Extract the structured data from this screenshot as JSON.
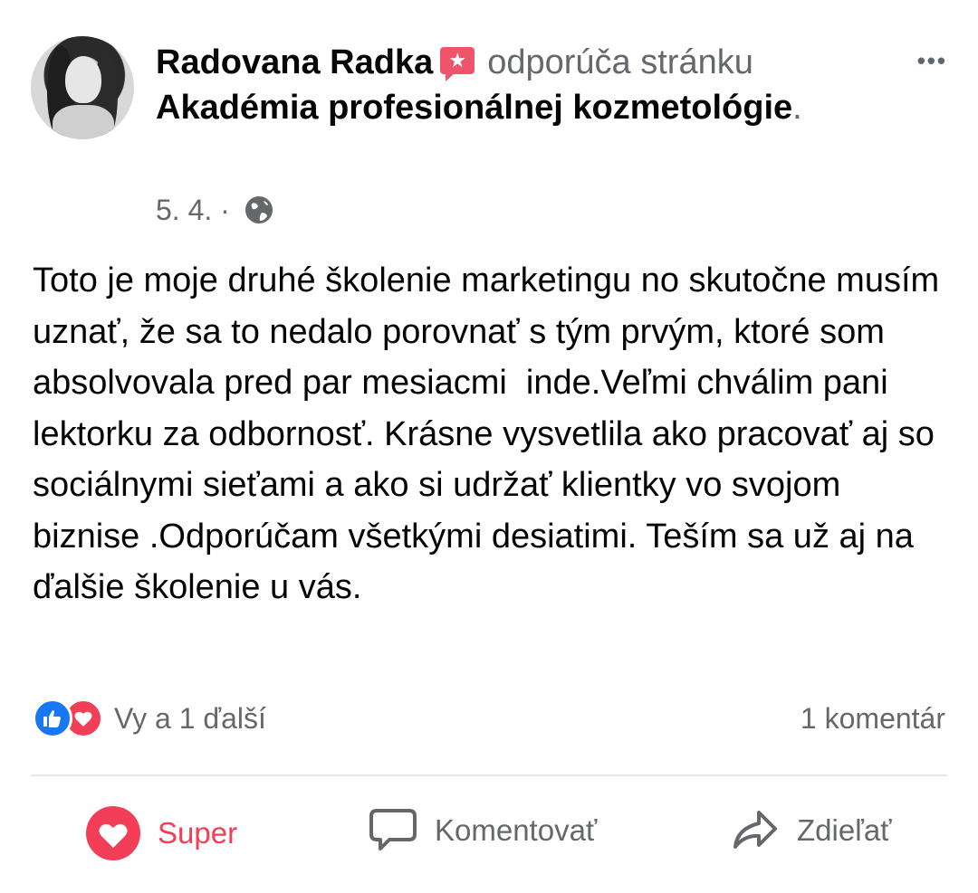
{
  "post": {
    "author": "Radovana Radka",
    "verb": "odporúča stránku",
    "page": "Akadémia profesionálnej kozmetológie",
    "trailing": ".",
    "date": "5. 4.",
    "separator": " · ",
    "body": "Toto je moje druhé školenie marketingu no skutočne musím uznať, že sa to nedalo porovnať s tým prvým, ktoré som absolvovala pred par mesiacmi  inde.Veľmi chválim pani lektorku za odbornosť. Krásne vysvetlila ako pracovať aj so sociálnymi sieťami a ako si udržať klientky vo svojom biznise .Odporúčam všetkými desiatimi. Teším sa už aj na ďalšie školenie u vás.",
    "more_icon": "•••",
    "badge_icon": "★"
  },
  "stats": {
    "reactions_text": "Vy a 1 ďalší",
    "comments_text": "1 komentár"
  },
  "actions": {
    "super": "Super",
    "comment": "Komentovať",
    "share": "Zdieľať"
  },
  "colors": {
    "like_blue": "#1877f2",
    "love_red": "#f33e58",
    "secondary_text": "#65676b",
    "badge_pink": "#f0546a"
  }
}
